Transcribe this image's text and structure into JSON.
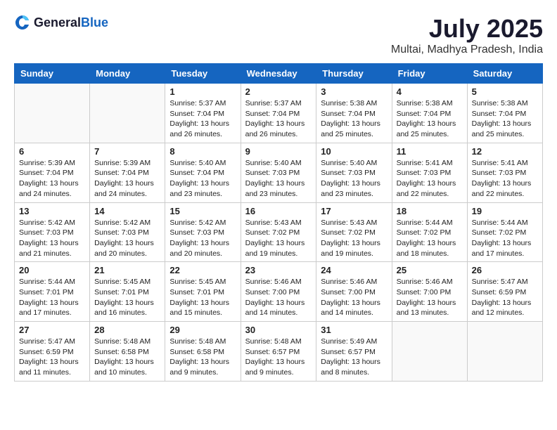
{
  "logo": {
    "text_general": "General",
    "text_blue": "Blue"
  },
  "header": {
    "month_year": "July 2025",
    "location": "Multai, Madhya Pradesh, India"
  },
  "weekdays": [
    "Sunday",
    "Monday",
    "Tuesday",
    "Wednesday",
    "Thursday",
    "Friday",
    "Saturday"
  ],
  "weeks": [
    [
      {
        "day": "",
        "details": ""
      },
      {
        "day": "",
        "details": ""
      },
      {
        "day": "1",
        "details": "Sunrise: 5:37 AM\nSunset: 7:04 PM\nDaylight: 13 hours and 26 minutes."
      },
      {
        "day": "2",
        "details": "Sunrise: 5:37 AM\nSunset: 7:04 PM\nDaylight: 13 hours and 26 minutes."
      },
      {
        "day": "3",
        "details": "Sunrise: 5:38 AM\nSunset: 7:04 PM\nDaylight: 13 hours and 25 minutes."
      },
      {
        "day": "4",
        "details": "Sunrise: 5:38 AM\nSunset: 7:04 PM\nDaylight: 13 hours and 25 minutes."
      },
      {
        "day": "5",
        "details": "Sunrise: 5:38 AM\nSunset: 7:04 PM\nDaylight: 13 hours and 25 minutes."
      }
    ],
    [
      {
        "day": "6",
        "details": "Sunrise: 5:39 AM\nSunset: 7:04 PM\nDaylight: 13 hours and 24 minutes."
      },
      {
        "day": "7",
        "details": "Sunrise: 5:39 AM\nSunset: 7:04 PM\nDaylight: 13 hours and 24 minutes."
      },
      {
        "day": "8",
        "details": "Sunrise: 5:40 AM\nSunset: 7:04 PM\nDaylight: 13 hours and 23 minutes."
      },
      {
        "day": "9",
        "details": "Sunrise: 5:40 AM\nSunset: 7:03 PM\nDaylight: 13 hours and 23 minutes."
      },
      {
        "day": "10",
        "details": "Sunrise: 5:40 AM\nSunset: 7:03 PM\nDaylight: 13 hours and 23 minutes."
      },
      {
        "day": "11",
        "details": "Sunrise: 5:41 AM\nSunset: 7:03 PM\nDaylight: 13 hours and 22 minutes."
      },
      {
        "day": "12",
        "details": "Sunrise: 5:41 AM\nSunset: 7:03 PM\nDaylight: 13 hours and 22 minutes."
      }
    ],
    [
      {
        "day": "13",
        "details": "Sunrise: 5:42 AM\nSunset: 7:03 PM\nDaylight: 13 hours and 21 minutes."
      },
      {
        "day": "14",
        "details": "Sunrise: 5:42 AM\nSunset: 7:03 PM\nDaylight: 13 hours and 20 minutes."
      },
      {
        "day": "15",
        "details": "Sunrise: 5:42 AM\nSunset: 7:03 PM\nDaylight: 13 hours and 20 minutes."
      },
      {
        "day": "16",
        "details": "Sunrise: 5:43 AM\nSunset: 7:02 PM\nDaylight: 13 hours and 19 minutes."
      },
      {
        "day": "17",
        "details": "Sunrise: 5:43 AM\nSunset: 7:02 PM\nDaylight: 13 hours and 19 minutes."
      },
      {
        "day": "18",
        "details": "Sunrise: 5:44 AM\nSunset: 7:02 PM\nDaylight: 13 hours and 18 minutes."
      },
      {
        "day": "19",
        "details": "Sunrise: 5:44 AM\nSunset: 7:02 PM\nDaylight: 13 hours and 17 minutes."
      }
    ],
    [
      {
        "day": "20",
        "details": "Sunrise: 5:44 AM\nSunset: 7:01 PM\nDaylight: 13 hours and 17 minutes."
      },
      {
        "day": "21",
        "details": "Sunrise: 5:45 AM\nSunset: 7:01 PM\nDaylight: 13 hours and 16 minutes."
      },
      {
        "day": "22",
        "details": "Sunrise: 5:45 AM\nSunset: 7:01 PM\nDaylight: 13 hours and 15 minutes."
      },
      {
        "day": "23",
        "details": "Sunrise: 5:46 AM\nSunset: 7:00 PM\nDaylight: 13 hours and 14 minutes."
      },
      {
        "day": "24",
        "details": "Sunrise: 5:46 AM\nSunset: 7:00 PM\nDaylight: 13 hours and 14 minutes."
      },
      {
        "day": "25",
        "details": "Sunrise: 5:46 AM\nSunset: 7:00 PM\nDaylight: 13 hours and 13 minutes."
      },
      {
        "day": "26",
        "details": "Sunrise: 5:47 AM\nSunset: 6:59 PM\nDaylight: 13 hours and 12 minutes."
      }
    ],
    [
      {
        "day": "27",
        "details": "Sunrise: 5:47 AM\nSunset: 6:59 PM\nDaylight: 13 hours and 11 minutes."
      },
      {
        "day": "28",
        "details": "Sunrise: 5:48 AM\nSunset: 6:58 PM\nDaylight: 13 hours and 10 minutes."
      },
      {
        "day": "29",
        "details": "Sunrise: 5:48 AM\nSunset: 6:58 PM\nDaylight: 13 hours and 9 minutes."
      },
      {
        "day": "30",
        "details": "Sunrise: 5:48 AM\nSunset: 6:57 PM\nDaylight: 13 hours and 9 minutes."
      },
      {
        "day": "31",
        "details": "Sunrise: 5:49 AM\nSunset: 6:57 PM\nDaylight: 13 hours and 8 minutes."
      },
      {
        "day": "",
        "details": ""
      },
      {
        "day": "",
        "details": ""
      }
    ]
  ]
}
